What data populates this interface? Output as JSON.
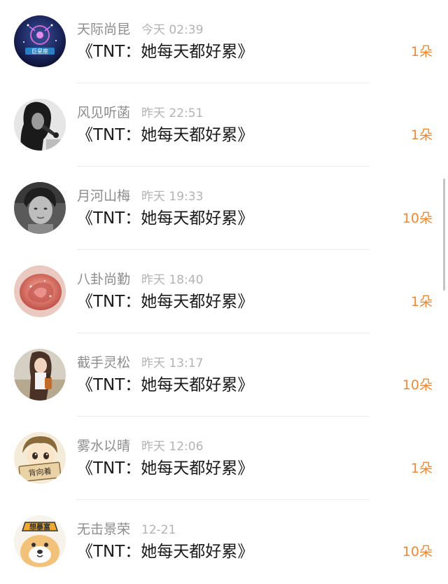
{
  "items": [
    {
      "name": "天际尚昆",
      "time": "今天 02:39",
      "title": "《TNT：她每天都好累》",
      "count": "1朵",
      "avatar_text": "巨星座",
      "avatar_icon": "constellation-avatar-icon"
    },
    {
      "name": "风见听菡",
      "time": "昨天 22:51",
      "title": "《TNT：她每天都好累》",
      "count": "1朵",
      "avatar_icon": "singer-photo-avatar-icon"
    },
    {
      "name": "月河山梅",
      "time": "昨天 19:33",
      "title": "《TNT：她每天都好累》",
      "count": "10朵",
      "avatar_icon": "portrait-photo-avatar-icon"
    },
    {
      "name": "八卦尚勤",
      "time": "昨天 18:40",
      "title": "《TNT：她每天都好累》",
      "count": "1朵",
      "avatar_icon": "rose-avatar-icon"
    },
    {
      "name": "截手灵松",
      "time": "昨天 13:17",
      "title": "《TNT：她每天都好累》",
      "count": "10朵",
      "avatar_icon": "girl-photo-avatar-icon"
    },
    {
      "name": "雾水以晴",
      "time": "昨天 12:06",
      "title": "《TNT：她每天都好累》",
      "count": "1朵",
      "avatar_text": "背向着",
      "avatar_icon": "cartoon-boy-avatar-icon"
    },
    {
      "name": "无击景荣",
      "time": "12-21",
      "title": "《TNT：她每天都好累》",
      "count": "10朵",
      "avatar_text": "想暴富",
      "avatar_icon": "cartoon-dog-avatar-icon"
    }
  ],
  "colors": {
    "count": "#e88a3a",
    "name": "#8c8c8c",
    "time": "#b3b3b3",
    "title": "#1a1a1a"
  }
}
